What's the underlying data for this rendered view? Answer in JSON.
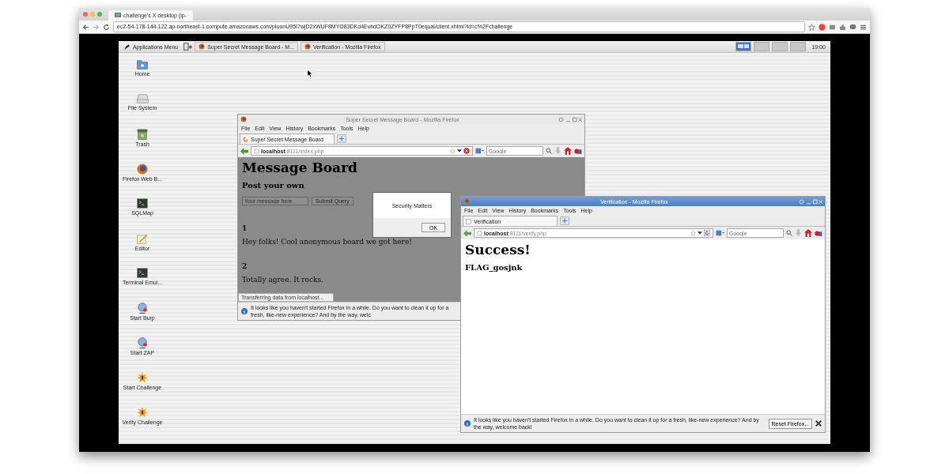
{
  "browser": {
    "tab_title": "challenge's X desktop (ip-",
    "url": "ec2-54-178-144-122.ap-northeast-1.compute.amazonaws.com/pluonU95I7wjD2xWUF8MYO83DKd4EvbdOKZ0ZYFP8PpT0equal/client.xhtml?id=c%2Fchallenge"
  },
  "taskbar": {
    "apps_menu": "Applications Menu",
    "tasks": [
      "Super Secret Message Board - M...",
      "Verification - Mozilla Firefox"
    ],
    "clock": "19:00"
  },
  "desktop_icons": [
    {
      "label": "Home",
      "kind": "folder"
    },
    {
      "label": "File System",
      "kind": "drive"
    },
    {
      "label": "Trash",
      "kind": "trash"
    },
    {
      "label": "Firefox Web B...",
      "kind": "firefox"
    },
    {
      "label": "SQLMap",
      "kind": "terminal"
    },
    {
      "label": "Editor",
      "kind": "editor"
    },
    {
      "label": "Terminal Emul...",
      "kind": "terminal"
    },
    {
      "label": "Start Burp",
      "kind": "network"
    },
    {
      "label": "Start ZAP",
      "kind": "network"
    },
    {
      "label": "Start Challenge",
      "kind": "burst"
    },
    {
      "label": "Verify Challenge",
      "kind": "burst"
    }
  ],
  "windows": [
    {
      "kind": "board",
      "active": false,
      "title": "Super Secret Message Board - Mozilla Firefox",
      "menu": [
        "File",
        "Edit",
        "View",
        "History",
        "Bookmarks",
        "Tools",
        "Help"
      ],
      "tab": "Super Secret Message Board",
      "url_host": "localhost",
      "url_path": ":8111/index.php",
      "search_placeholder": "Google",
      "heading": "Message Board",
      "subheading": "Post your own",
      "input_placeholder": "Your message here",
      "submit": "Submit Query",
      "posts": [
        {
          "number": "1",
          "text": "Hey folks! Cool anonymous board we got here!"
        },
        {
          "number": "2",
          "text": "Totally agree. It rocks."
        }
      ],
      "dialog": {
        "message": "Security Matters",
        "button": "OK"
      },
      "status": "Transferring data from localhost...",
      "notification": "It looks like you haven't started Firefox in a while. Do you want to clean it up for a fresh, like-new experience? And by the way, welc"
    },
    {
      "kind": "result",
      "active": true,
      "title": "Verification - Mozilla Firefox",
      "menu": [
        "File",
        "Edit",
        "View",
        "History",
        "Bookmarks",
        "Tools",
        "Help"
      ],
      "tab": "Verification",
      "url_host": "localhost",
      "url_path": ":8111/verify.php",
      "search_placeholder": "Google",
      "heading": "Success!",
      "flag": "FLAG_gosjnk",
      "notification": "It looks like you haven't started Firefox in a while. Do you want to clean it up for a fresh, like-new experience? And by the way, welcome back!",
      "notification_button": "Reset Firefox..."
    }
  ]
}
